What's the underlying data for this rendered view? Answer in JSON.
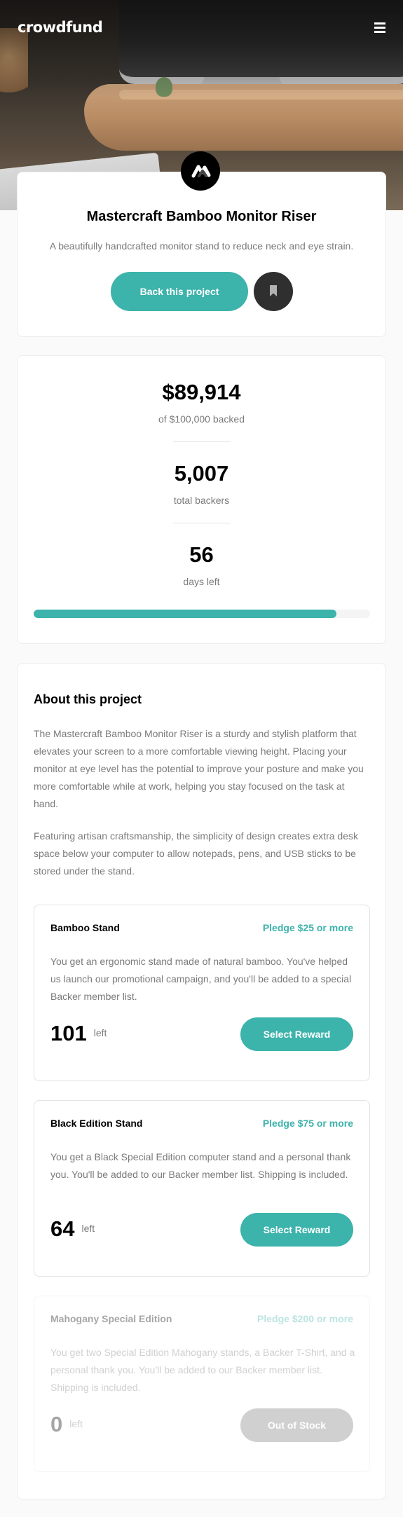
{
  "header": {
    "logo": "crowdfund",
    "menu_icon": "hamburger-icon"
  },
  "intro": {
    "title": "Mastercraft Bamboo Monitor Riser",
    "description": "A beautifully handcrafted monitor stand to reduce neck and eye strain.",
    "back_button": "Back this project",
    "bookmark_icon": "bookmark-icon"
  },
  "stats": {
    "backed_amount": "$89,914",
    "backed_label": "of $100,000 backed",
    "backers": "5,007",
    "backers_label": "total backers",
    "days": "56",
    "days_label": "days left",
    "progress_fraction": 0.899
  },
  "about": {
    "title": "About this project",
    "paragraph1": "The Mastercraft Bamboo Monitor Riser is a sturdy and stylish platform that elevates your screen to a more comfortable viewing height. Placing your monitor at eye level has the potential to improve your posture and make you more comfortable while at work, helping you stay focused on the task at hand.",
    "paragraph2": "Featuring artisan craftsmanship, the simplicity of design creates extra desk space below your computer to allow notepads, pens, and USB sticks to be stored under the stand."
  },
  "rewards": [
    {
      "name": "Bamboo Stand",
      "pledge": "Pledge $25 or more",
      "description": "You get an ergonomic stand made of natural bamboo. You've helped us launch our promotional campaign, and you'll be added to a special Backer member list.",
      "count": "101",
      "left_label": "left",
      "button": "Select Reward"
    },
    {
      "name": "Black Edition Stand",
      "pledge": "Pledge $75 or more",
      "description": "You get a Black Special Edition computer stand and a personal thank you. You'll be added to our Backer member list. Shipping is included.",
      "count": "64",
      "left_label": "left",
      "button": "Select Reward"
    },
    {
      "name": "Mahogany Special Edition",
      "pledge": "Pledge $200 or more",
      "description": "You get two Special Edition Mahogany stands, a Backer T-Shirt, and a personal thank you. You'll be added to our Backer member list. Shipping is included.",
      "count": "0",
      "left_label": "left",
      "button": "Out of Stock"
    }
  ],
  "colors": {
    "accent": "#3cb3ab",
    "dark": "#2f2f2f",
    "muted_text": "#7a7a7a"
  }
}
